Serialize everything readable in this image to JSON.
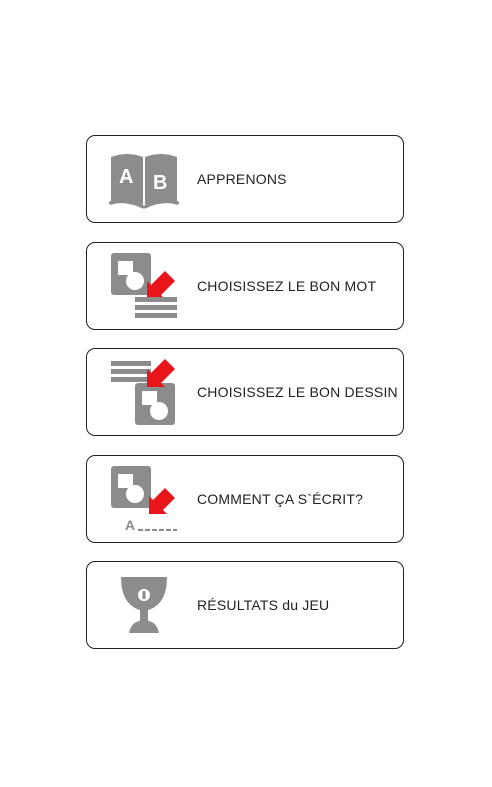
{
  "menu": {
    "items": [
      {
        "label": "APPRENONS",
        "icon": "book-ab-icon"
      },
      {
        "label": "CHOISISSEZ LE BON MOT",
        "icon": "picture-to-word-icon"
      },
      {
        "label": "CHOISISSEZ LE BON DESSIN",
        "icon": "word-to-picture-icon"
      },
      {
        "label": "COMMENT ÇA S`ÉCRIT?",
        "icon": "spell-word-icon"
      },
      {
        "label": "RÉSULTATS du JEU",
        "icon": "trophy-cup-icon"
      }
    ]
  },
  "icon_letters": {
    "book_left": "A",
    "book_right": "B",
    "spell_letter": "A"
  },
  "colors": {
    "icon_gray": "#8c8c8c",
    "arrow_red": "#e8161b",
    "border": "#222222"
  }
}
